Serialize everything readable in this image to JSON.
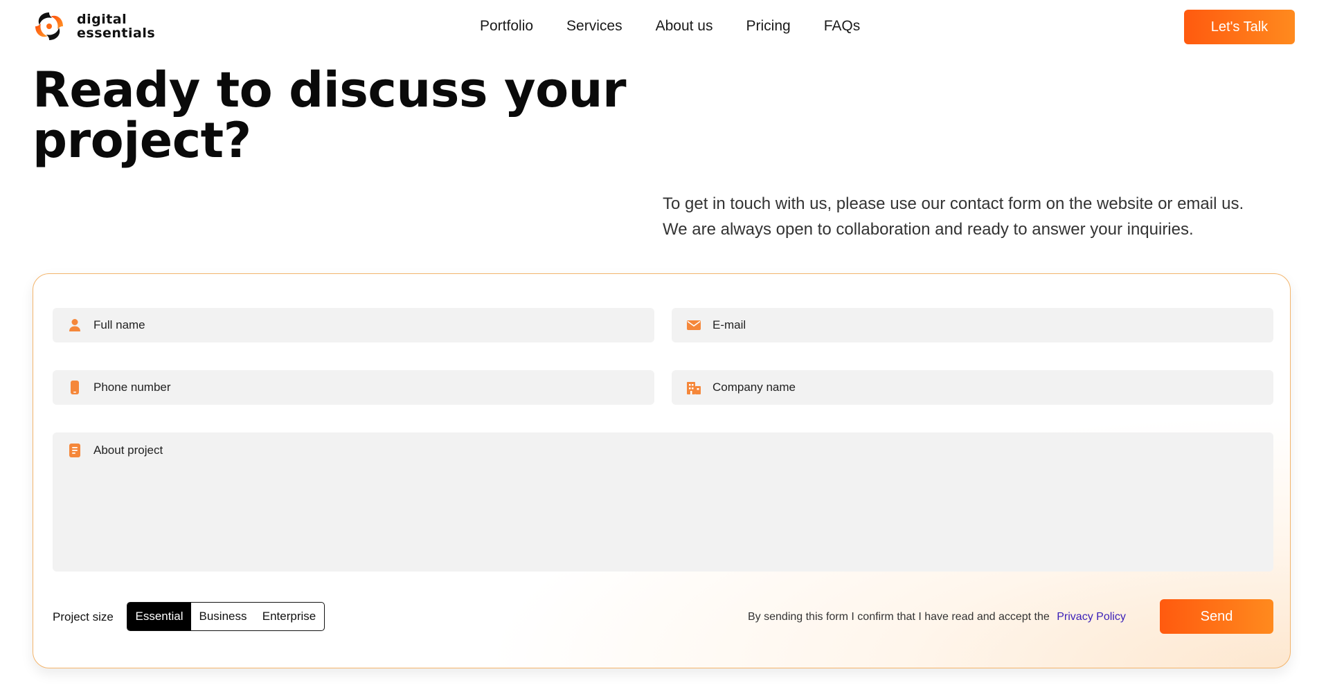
{
  "header": {
    "logo_line1": "digital",
    "logo_line2": "essentials",
    "nav": [
      "Portfolio",
      "Services",
      "About us",
      "Pricing",
      "FAQs"
    ],
    "cta_label": "Let's Talk"
  },
  "hero": {
    "title_line1": "Ready to discuss your",
    "title_line2": "project?",
    "intro_line1": "To get in touch with us, please use our contact form on the website or email us.",
    "intro_line2": "We are always open to collaboration and ready to answer your inquiries."
  },
  "form": {
    "full_name_placeholder": "Full name",
    "email_placeholder": "E-mail",
    "phone_placeholder": "Phone number",
    "company_placeholder": "Company name",
    "about_placeholder": "About project",
    "project_size_label": "Project size",
    "sizes": [
      "Essential",
      "Business",
      "Enterprise"
    ],
    "selected_size": "Essential",
    "consent_text": "By sending this form I confirm that I have read and accept the",
    "privacy_link": "Privacy Policy",
    "send_label": "Send"
  },
  "colors": {
    "accent_start": "#ff5a0f",
    "accent_end": "#ff8a1e",
    "icon": "#f5873a",
    "link": "#3a1fb8"
  }
}
